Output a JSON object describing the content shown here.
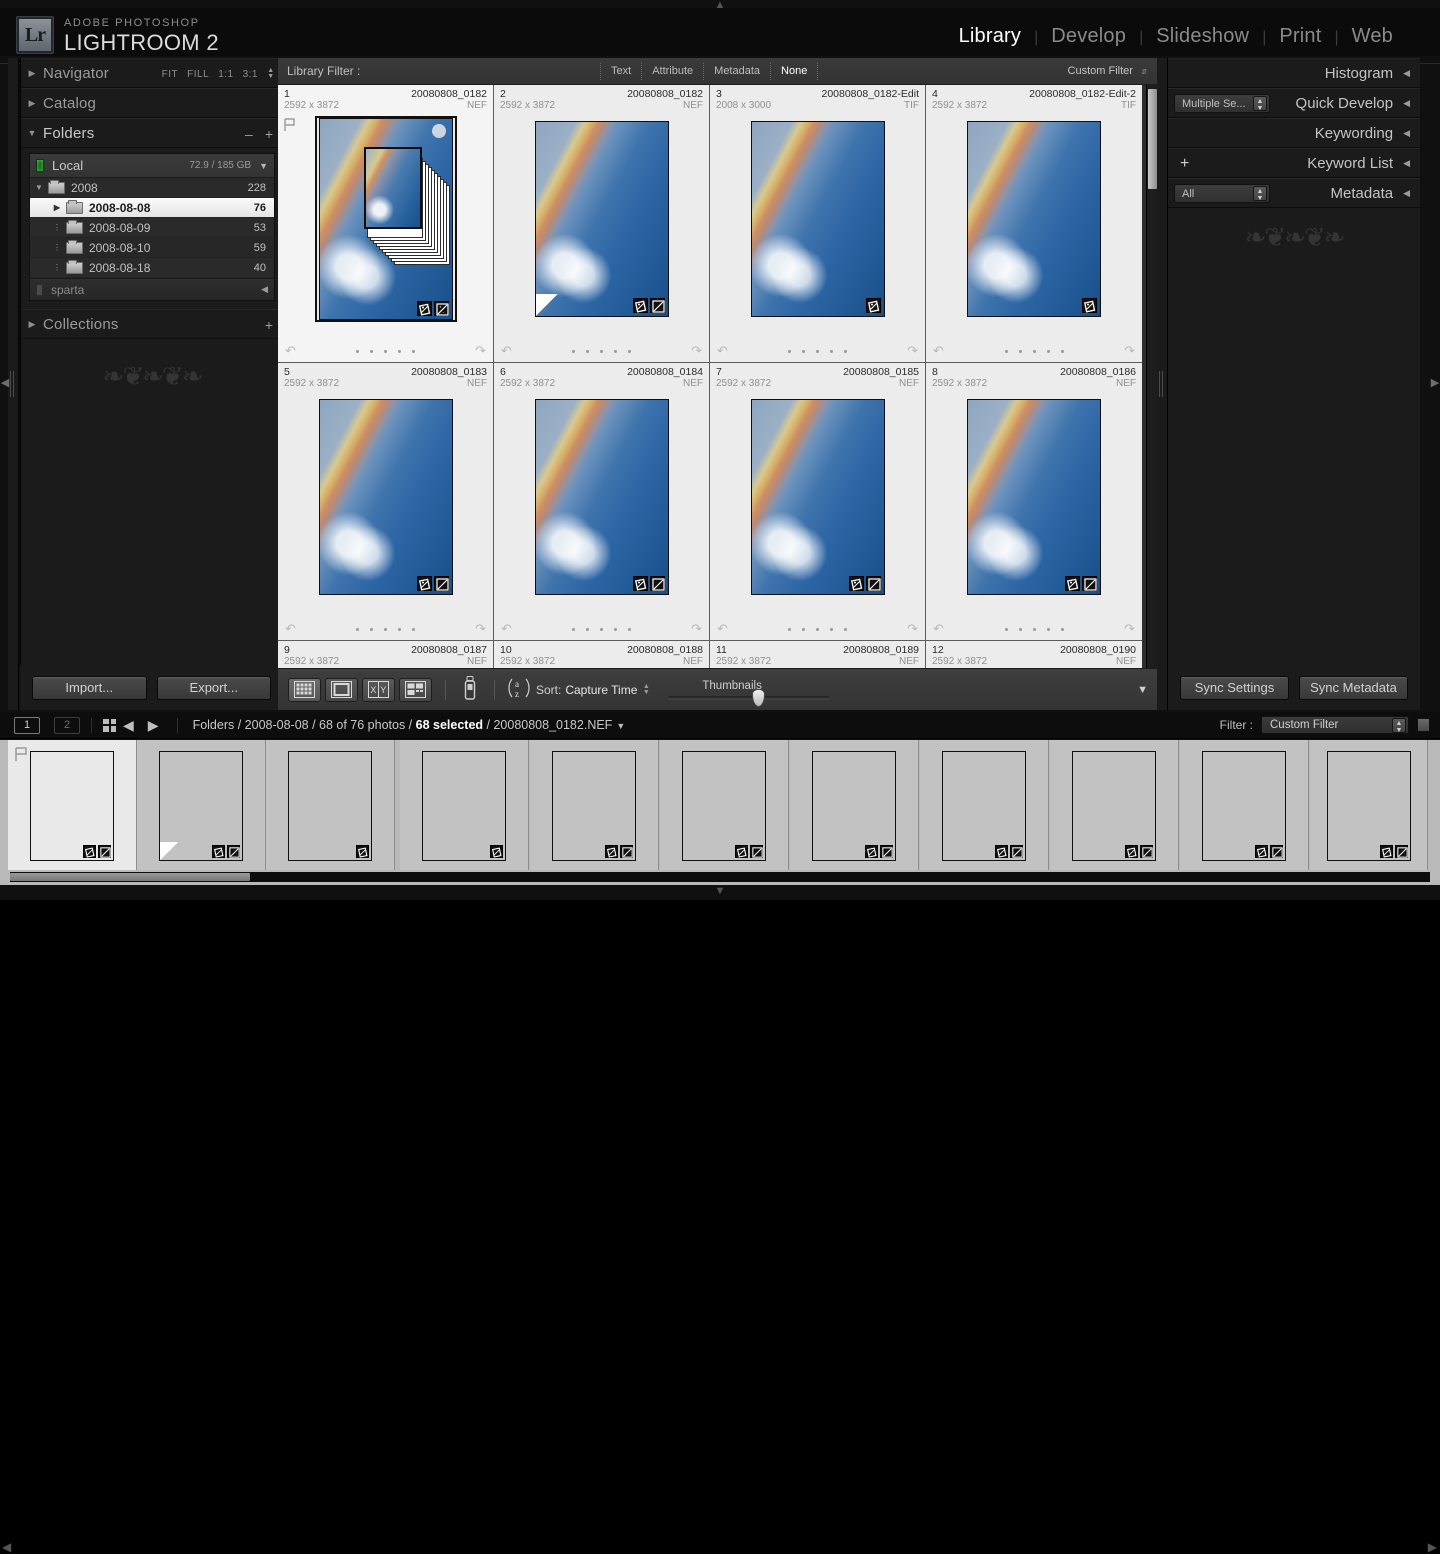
{
  "app": {
    "logo_text": "Lr",
    "brand_small": "ADOBE PHOTOSHOP",
    "brand_big": "LIGHTROOM 2"
  },
  "modules": [
    {
      "label": "Library",
      "active": true
    },
    {
      "label": "Develop",
      "active": false
    },
    {
      "label": "Slideshow",
      "active": false
    },
    {
      "label": "Print",
      "active": false
    },
    {
      "label": "Web",
      "active": false
    }
  ],
  "left_panel": {
    "navigator": {
      "title": "Navigator",
      "modes": [
        "FIT",
        "FILL",
        "1:1",
        "3:1"
      ]
    },
    "catalog": {
      "title": "Catalog"
    },
    "folders": {
      "title": "Folders",
      "minus_label": "–",
      "plus_label": "+",
      "volume": {
        "name": "Local",
        "space": "72.9 / 185 GB"
      },
      "tree": [
        {
          "name": "2008",
          "count": "228",
          "indent": 0,
          "expanded": true,
          "selected": false
        },
        {
          "name": "2008-08-08",
          "count": "76",
          "indent": 1,
          "expanded": false,
          "selected": true
        },
        {
          "name": "2008-08-09",
          "count": "53",
          "indent": 1,
          "expanded": false,
          "selected": false
        },
        {
          "name": "2008-08-10",
          "count": "59",
          "indent": 1,
          "expanded": false,
          "selected": false
        },
        {
          "name": "2008-08-18",
          "count": "40",
          "indent": 1,
          "expanded": false,
          "selected": false
        }
      ],
      "second_volume": {
        "name": "sparta"
      }
    },
    "collections": {
      "title": "Collections",
      "plus_label": "+"
    },
    "buttons": {
      "import": "Import...",
      "export": "Export..."
    }
  },
  "filter_bar": {
    "label": "Library Filter :",
    "tabs": [
      {
        "label": "Text",
        "active": false
      },
      {
        "label": "Attribute",
        "active": false
      },
      {
        "label": "Metadata",
        "active": false
      },
      {
        "label": "None",
        "active": true
      }
    ],
    "custom_filter": "Custom Filter"
  },
  "grid": {
    "cells": [
      {
        "index": "1",
        "name": "20080808_0182",
        "dimensions": "2592 x 3872",
        "format": "NEF",
        "state": "active",
        "badges": [
          "crop-badge",
          "develop-badge"
        ],
        "flag": true
      },
      {
        "index": "2",
        "name": "20080808_0182",
        "dimensions": "2592 x 3872",
        "format": "NEF",
        "state": "selected",
        "badges": [
          "crop-badge",
          "develop-badge"
        ],
        "corner": true
      },
      {
        "index": "3",
        "name": "20080808_0182-Edit",
        "dimensions": "2008 x 3000",
        "format": "TIF",
        "state": "selected",
        "badges": [
          "crop-badge"
        ]
      },
      {
        "index": "4",
        "name": "20080808_0182-Edit-2",
        "dimensions": "2592 x 3872",
        "format": "TIF",
        "state": "selected",
        "badges": [
          "crop-badge"
        ]
      },
      {
        "index": "5",
        "name": "20080808_0183",
        "dimensions": "2592 x 3872",
        "format": "NEF",
        "state": "selected",
        "badges": [
          "crop-badge",
          "develop-badge"
        ]
      },
      {
        "index": "6",
        "name": "20080808_0184",
        "dimensions": "2592 x 3872",
        "format": "NEF",
        "state": "selected",
        "badges": [
          "crop-badge",
          "develop-badge"
        ]
      },
      {
        "index": "7",
        "name": "20080808_0185",
        "dimensions": "2592 x 3872",
        "format": "NEF",
        "state": "selected",
        "badges": [
          "crop-badge",
          "develop-badge"
        ]
      },
      {
        "index": "8",
        "name": "20080808_0186",
        "dimensions": "2592 x 3872",
        "format": "NEF",
        "state": "selected",
        "badges": [
          "crop-badge",
          "develop-badge"
        ]
      },
      {
        "index": "9",
        "name": "20080808_0187",
        "dimensions": "2592 x 3872",
        "format": "NEF",
        "state": "selected",
        "badges": []
      },
      {
        "index": "10",
        "name": "20080808_0188",
        "dimensions": "2592 x 3872",
        "format": "NEF",
        "state": "selected",
        "badges": []
      },
      {
        "index": "11",
        "name": "20080808_0189",
        "dimensions": "2592 x 3872",
        "format": "NEF",
        "state": "selected",
        "badges": []
      },
      {
        "index": "12",
        "name": "20080808_0190",
        "dimensions": "2592 x 3872",
        "format": "NEF",
        "state": "selected",
        "badges": []
      }
    ],
    "rating_dots": 5
  },
  "toolbar": {
    "view_buttons": [
      "grid-view-icon",
      "loupe-view-icon",
      "compare-view-icon",
      "survey-view-icon"
    ],
    "spray_button": "spray-can-icon",
    "sort_icon": "az-sort-icon",
    "sort_label": "Sort:",
    "sort_value": "Capture Time",
    "thumbnails_label": "Thumbnails",
    "thumbnail_size_percent": 52
  },
  "right_panel": {
    "panels": [
      {
        "title": "Histogram",
        "control": null
      },
      {
        "title": "Quick Develop",
        "control": {
          "type": "combo",
          "value": "Multiple Se..."
        }
      },
      {
        "title": "Keywording",
        "control": null
      },
      {
        "title": "Keyword List",
        "control": {
          "type": "plus",
          "value": "+"
        }
      },
      {
        "title": "Metadata",
        "control": {
          "type": "combo",
          "value": "All"
        }
      }
    ],
    "buttons": {
      "sync_settings": "Sync Settings",
      "sync_metadata": "Sync Metadata"
    }
  },
  "status_bar": {
    "page_boxes": [
      {
        "label": "1",
        "active": true
      },
      {
        "label": "2",
        "active": false
      }
    ],
    "breadcrumb_prefix": "Folders / 2008-08-08 / 68 of 76 photos / ",
    "breadcrumb_selected": "68 selected",
    "breadcrumb_suffix": " / 20080808_0182.NEF",
    "filter_label": "Filter :",
    "filter_value": "Custom Filter"
  },
  "filmstrip": {
    "count": 11,
    "selected_index": 0,
    "badges_per_cell": [
      [
        "crop-badge",
        "develop-badge"
      ],
      [
        "crop-badge",
        "develop-badge"
      ],
      [
        "crop-badge"
      ],
      [
        "crop-badge"
      ],
      [
        "crop-badge",
        "develop-badge"
      ],
      [
        "crop-badge",
        "develop-badge"
      ],
      [
        "crop-badge",
        "develop-badge"
      ],
      [
        "crop-badge",
        "develop-badge"
      ],
      [
        "crop-badge",
        "develop-badge"
      ],
      [
        "crop-badge",
        "develop-badge"
      ],
      [
        "crop-badge",
        "develop-badge"
      ]
    ]
  },
  "colors": {
    "app_bg": "#1b1b1b",
    "grid_bg": "#2e2e2e",
    "cell_bg": "#bdbdbd",
    "cell_selected_bg": "#ececec",
    "accent_text": "#ffffff"
  }
}
